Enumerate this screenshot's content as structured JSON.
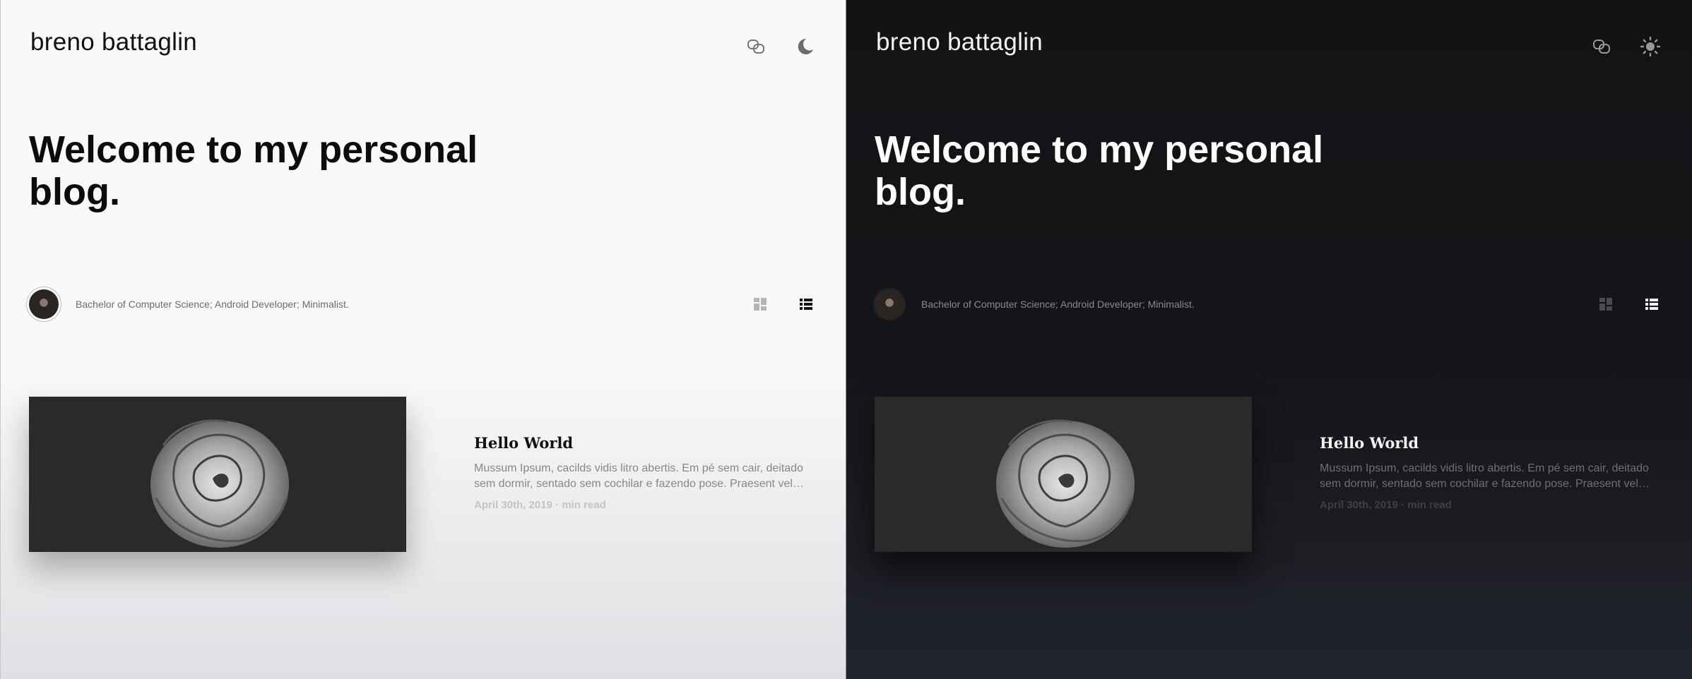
{
  "colors": {
    "light_bg": "#f9f9f9",
    "dark_bg": "#131316",
    "image_bg": "#2a2a2a"
  },
  "site": {
    "title": "breno battaglin"
  },
  "icons": {
    "link": "chain-link-icon",
    "theme_light_mode": "moon-icon",
    "theme_dark_mode": "sun-icon",
    "grid_view": "grid-view-icon",
    "list_view": "list-view-icon"
  },
  "hero": {
    "line1": "Welcome to my personal",
    "line2": "blog."
  },
  "author": {
    "bio": "Bachelor of Computer Science; Android Developer; Minimalist."
  },
  "post": {
    "title": "Hello World",
    "excerpt_line1": "Mussum Ipsum, cacilds vidis litro abertis. Em pé sem cair, deitado",
    "excerpt_line2": "sem dormir, sentado sem cochilar e fazendo pose. Praesent vel…",
    "meta": "April 30th, 2019 · min read"
  }
}
